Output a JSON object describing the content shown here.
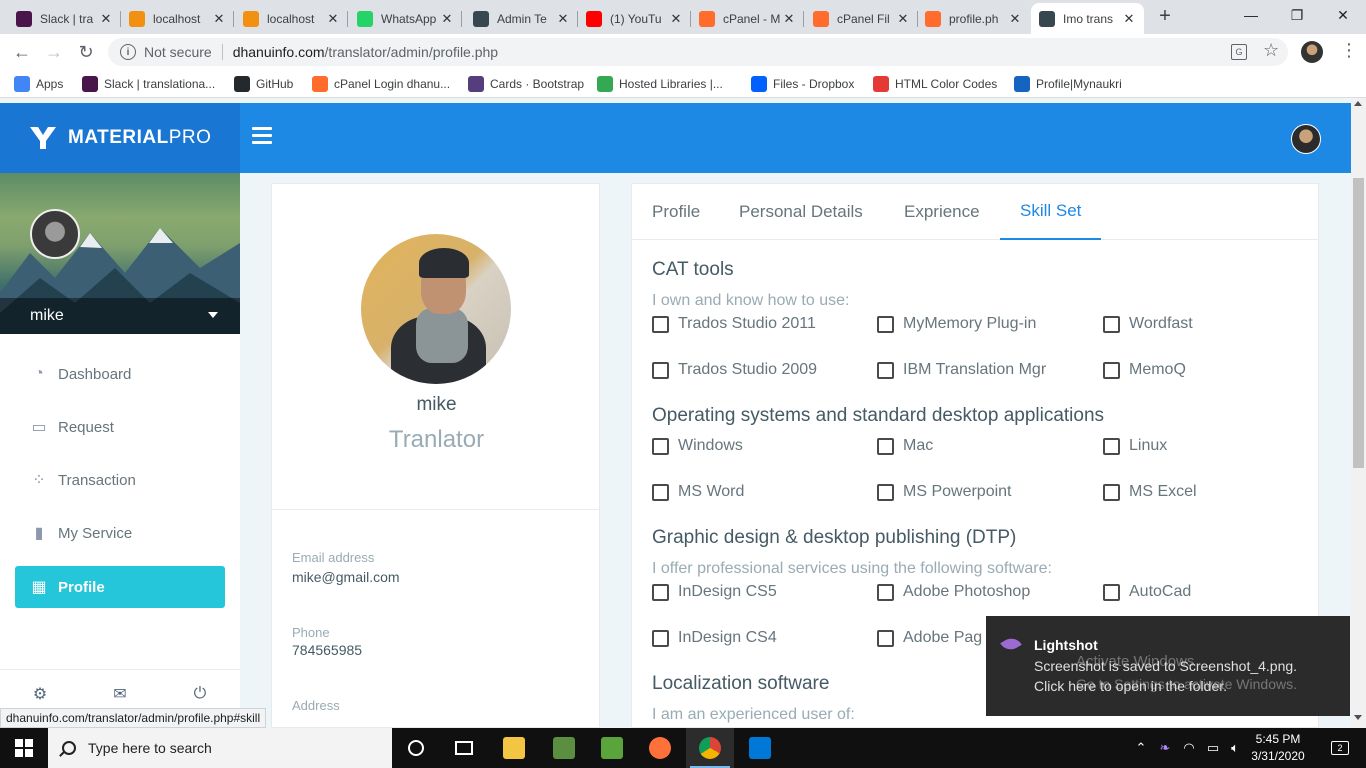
{
  "browser": {
    "tabs": [
      {
        "label": "Slack | tra",
        "icon": "slack-icon",
        "color": "#4a154b"
      },
      {
        "label": "localhost",
        "icon": "phpmyadmin-icon",
        "color": "#f29111"
      },
      {
        "label": "localhost",
        "icon": "phpmyadmin-icon",
        "color": "#f29111"
      },
      {
        "label": "WhatsApp",
        "icon": "whatsapp-icon",
        "color": "#25d366"
      },
      {
        "label": "Admin Te",
        "icon": "materialpro-icon",
        "color": "#37474f"
      },
      {
        "label": "(1) YouTu",
        "icon": "youtube-icon",
        "color": "#ff0000"
      },
      {
        "label": "cPanel - M",
        "icon": "cpanel-icon",
        "color": "#ff6c2c"
      },
      {
        "label": "cPanel Fil",
        "icon": "cpanel-icon",
        "color": "#ff6c2c"
      },
      {
        "label": "profile.ph",
        "icon": "cpanel-icon",
        "color": "#ff6c2c"
      },
      {
        "label": "Imo trans",
        "icon": "materialpro-icon",
        "color": "#37474f"
      }
    ],
    "tab_close": "✕",
    "new_tab": "+",
    "window_controls": {
      "minimize": "—",
      "maximize": "❐",
      "close": "✕"
    },
    "not_secure": "Not secure",
    "url_host": "dhanuinfo.com",
    "url_path": "/translator/admin/profile.php",
    "bookmarks": [
      {
        "label": "Apps",
        "icon": "apps-grid-icon",
        "color": "#4285f4"
      },
      {
        "label": "Slack | translationa...",
        "icon": "slack-icon",
        "color": "#4a154b"
      },
      {
        "label": "GitHub",
        "icon": "github-icon",
        "color": "#24292e"
      },
      {
        "label": "cPanel Login dhanu...",
        "icon": "cpanel-icon",
        "color": "#ff6c2c"
      },
      {
        "label": "Cards · Bootstrap",
        "icon": "bootstrap-icon",
        "color": "#563d7c"
      },
      {
        "label": "Hosted Libraries |...",
        "icon": "code-icon",
        "color": "#34a853"
      },
      {
        "label": "Files - Dropbox",
        "icon": "dropbox-icon",
        "color": "#0061ff"
      },
      {
        "label": "HTML Color Codes",
        "icon": "color-codes-icon",
        "color": "#e53935"
      },
      {
        "label": "Profile|Mynaukri",
        "icon": "naukri-icon",
        "color": "#1565c0"
      }
    ]
  },
  "app": {
    "logo_main": "MATERIAL",
    "logo_suffix": "PRO",
    "brand_color": "#1e88e5",
    "accent_color": "#26c6da"
  },
  "sidebar": {
    "user_name": "mike",
    "nav": [
      {
        "label": "Dashboard",
        "icon": "gauge-icon"
      },
      {
        "label": "Request",
        "icon": "laptop-icon"
      },
      {
        "label": "Transaction",
        "icon": "bubbles-icon"
      },
      {
        "label": "My Service",
        "icon": "file-icon"
      },
      {
        "label": "Profile",
        "icon": "widgets-icon",
        "active": true
      }
    ],
    "footer_icons": [
      "settings-icon",
      "mail-icon",
      "power-icon"
    ]
  },
  "profile": {
    "name": "mike",
    "role": "Tranlator",
    "email_label": "Email address",
    "email": "mike@gmail.com",
    "phone_label": "Phone",
    "phone": "784565985",
    "address_label": "Address"
  },
  "skills": {
    "tabs": [
      "Profile",
      "Personal Details",
      "Exprience",
      "Skill Set"
    ],
    "active_tab": "Skill Set",
    "sections": [
      {
        "title": "CAT tools",
        "subtitle": "I own and know how to use:",
        "items": [
          "Trados Studio 2011",
          "MyMemory Plug-in",
          "Wordfast",
          "Trados Studio 2009",
          "IBM Translation Mgr",
          "MemoQ"
        ]
      },
      {
        "title": "Operating systems and standard desktop applications",
        "subtitle": "",
        "items": [
          "Windows",
          "Mac",
          "Linux",
          "MS Word",
          "MS Powerpoint",
          "MS Excel"
        ]
      },
      {
        "title": "Graphic design & desktop publishing (DTP)",
        "subtitle": "I offer professional services using the following software:",
        "items": [
          "InDesign CS5",
          "Adobe Photoshop",
          "AutoCad",
          "InDesign CS4",
          "Adobe Pag"
        ]
      },
      {
        "title": "Localization software",
        "subtitle": "I am an experienced user of:",
        "items": []
      }
    ]
  },
  "status_link": "dhanuinfo.com/translator/admin/profile.php#skill",
  "toast": {
    "title": "Lightshot",
    "line1": "Screenshot is saved to Screenshot_4.png.",
    "line2": "Click here to open in the folder.",
    "watermark1": "Activate Windows",
    "watermark2": "Go to Settings to activate Windows."
  },
  "taskbar": {
    "search_placeholder": "Type here to search",
    "apps": [
      "cortana-icon",
      "task-view-icon",
      "file-explorer-icon",
      "network-app-icon",
      "notepad-icon",
      "firefox-icon",
      "chrome-icon",
      "vscode-icon"
    ],
    "time": "5:45 PM",
    "date": "3/31/2020",
    "notification_count": "2"
  }
}
